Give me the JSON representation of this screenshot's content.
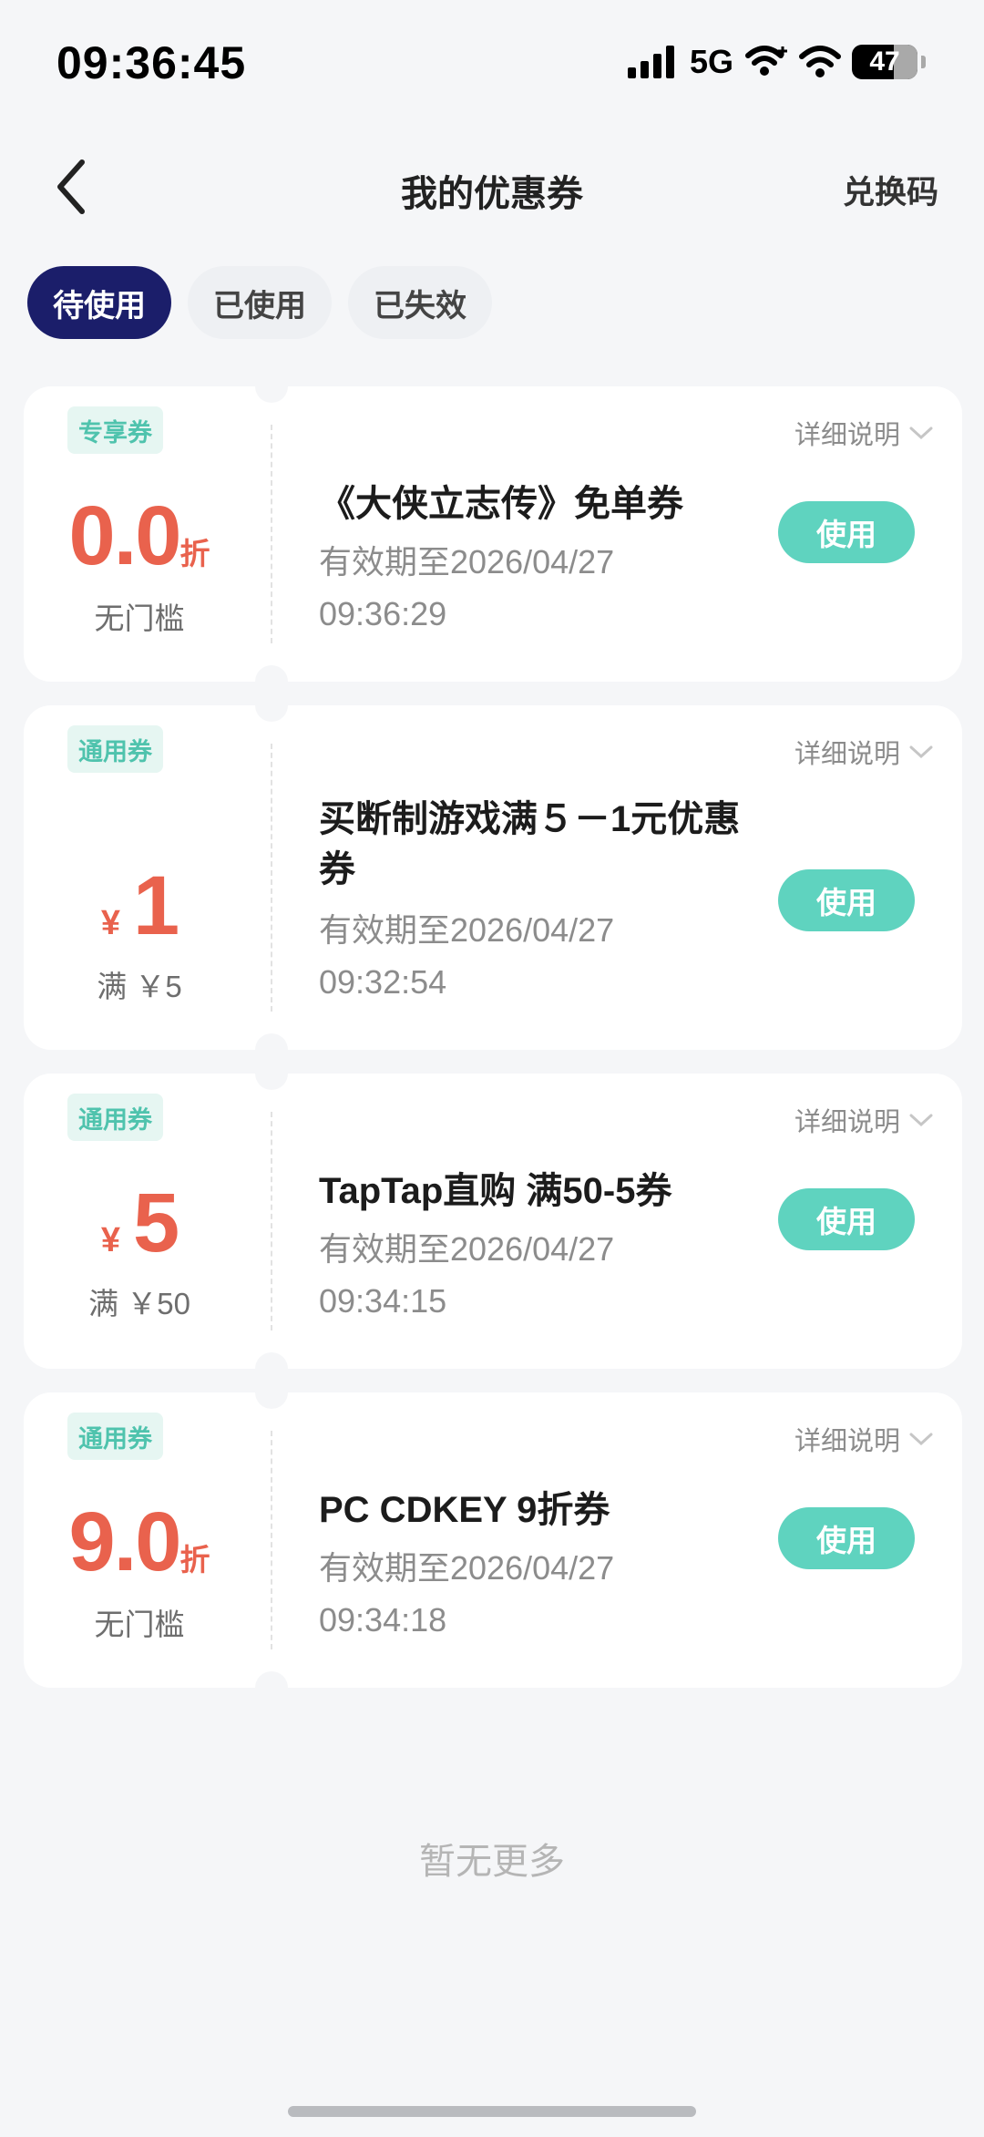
{
  "status_bar": {
    "time": "09:36:45",
    "network": "5G",
    "battery": "47"
  },
  "nav": {
    "title": "我的优惠券",
    "redeem": "兑换码"
  },
  "tabs": [
    {
      "label": "待使用",
      "active": true
    },
    {
      "label": "已使用",
      "active": false
    },
    {
      "label": "已失效",
      "active": false
    }
  ],
  "coupons": [
    {
      "tag": "专享券",
      "amount": "0.0",
      "unit": "折",
      "condition": "无门槛",
      "name": "《大侠立志传》免单券",
      "valid_line1": "有效期至2026/04/27",
      "valid_line2": "09:36:29",
      "detail": "详细说明",
      "use": "使用"
    },
    {
      "tag": "通用券",
      "currency": "¥",
      "amount": "1",
      "condition": "满 ￥5",
      "name": "买断制游戏满５－1元优惠券",
      "valid_line1": "有效期至2026/04/27",
      "valid_line2": "09:32:54",
      "detail": "详细说明",
      "use": "使用"
    },
    {
      "tag": "通用券",
      "currency": "¥",
      "amount": "5",
      "condition": "满 ￥50",
      "name": "TapTap直购 满50-5券",
      "valid_line1": "有效期至2026/04/27",
      "valid_line2": "09:34:15",
      "detail": "详细说明",
      "use": "使用"
    },
    {
      "tag": "通用券",
      "amount": "9.0",
      "unit": "折",
      "condition": "无门槛",
      "name": "PC CDKEY 9折券",
      "valid_line1": "有效期至2026/04/27",
      "valid_line2": "09:34:18",
      "detail": "详细说明",
      "use": "使用"
    }
  ],
  "footer": {
    "no_more": "暂无更多"
  },
  "colors": {
    "accent_navy": "#1b1e6a",
    "teal": "#5fd3bf",
    "amount_red": "#e9624d"
  },
  "icons": [
    "back-arrow-icon",
    "signal-icon",
    "wifi-icon",
    "battery-icon",
    "chevron-down-icon"
  ]
}
